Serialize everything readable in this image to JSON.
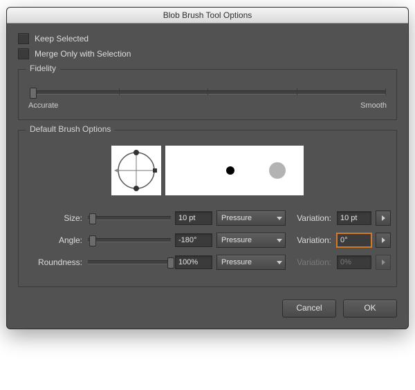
{
  "window": {
    "title": "Blob Brush Tool Options"
  },
  "checkboxes": {
    "keep_selected": {
      "label": "Keep Selected",
      "checked": false
    },
    "merge_only": {
      "label": "Merge Only with Selection",
      "checked": false
    }
  },
  "fidelity": {
    "title": "Fidelity",
    "left_label": "Accurate",
    "right_label": "Smooth",
    "value": 0
  },
  "brush": {
    "title": "Default Brush Options",
    "rows": {
      "size": {
        "label": "Size:",
        "value": "10 pt",
        "slider": 0.02,
        "control": "Pressure",
        "variation_label": "Variation:",
        "variation": "10 pt",
        "variation_enabled": true
      },
      "angle": {
        "label": "Angle:",
        "value": "-180°",
        "slider": 0.02,
        "control": "Pressure",
        "variation_label": "Variation:",
        "variation": "0°",
        "variation_enabled": true,
        "variation_focused": true
      },
      "roundness": {
        "label": "Roundness:",
        "value": "100%",
        "slider": 0.98,
        "control": "Pressure",
        "variation_label": "Variation:",
        "variation": "0%",
        "variation_enabled": false
      }
    }
  },
  "buttons": {
    "cancel": "Cancel",
    "ok": "OK"
  }
}
